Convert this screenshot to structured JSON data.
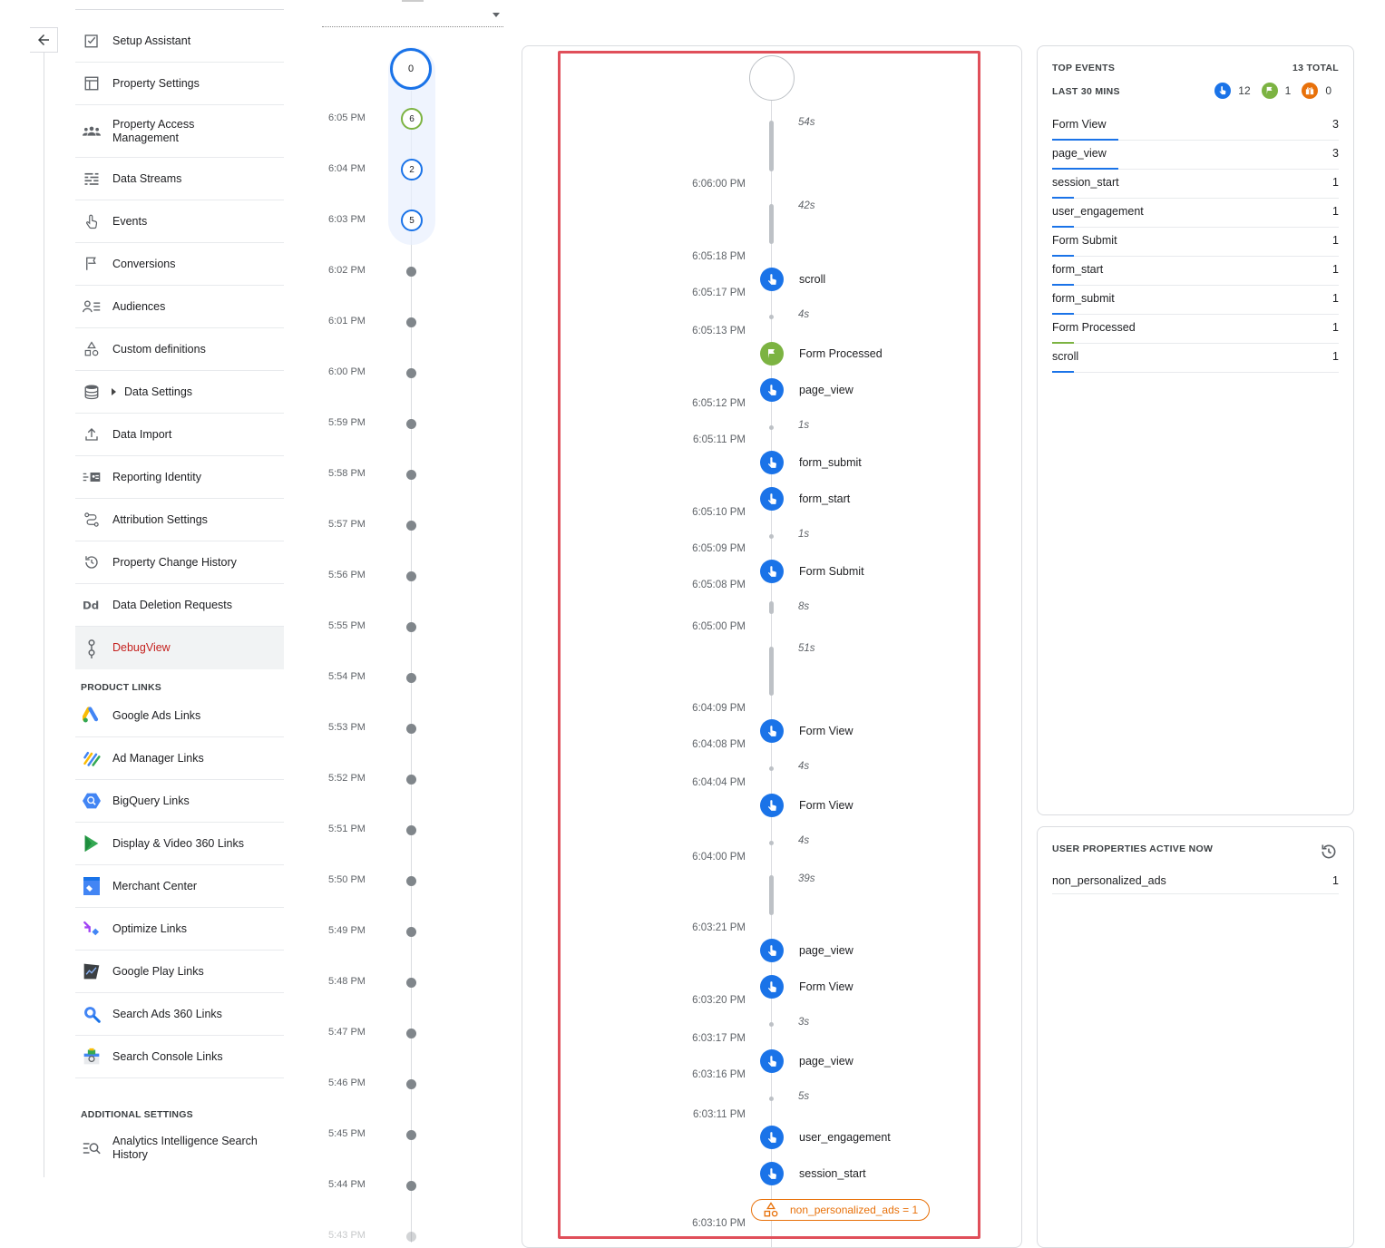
{
  "nav": {
    "items": [
      {
        "label": "Setup Assistant",
        "icon": "checkbox-icon"
      },
      {
        "label": "Property Settings",
        "icon": "layout-icon"
      },
      {
        "label": "Property Access Management",
        "icon": "people-icon"
      },
      {
        "label": "Data Streams",
        "icon": "streams-icon"
      },
      {
        "label": "Events",
        "icon": "touch-icon"
      },
      {
        "label": "Conversions",
        "icon": "flag-icon"
      },
      {
        "label": "Audiences",
        "icon": "audience-icon"
      },
      {
        "label": "Custom definitions",
        "icon": "shapes-icon"
      },
      {
        "label": "Data Settings",
        "icon": "database-icon"
      },
      {
        "label": "Data Import",
        "icon": "upload-icon"
      },
      {
        "label": "Reporting Identity",
        "icon": "identity-icon"
      },
      {
        "label": "Attribution Settings",
        "icon": "attribution-icon"
      },
      {
        "label": "Property Change History",
        "icon": "history-icon"
      },
      {
        "label": "Data Deletion Requests",
        "icon": "dd-icon"
      },
      {
        "label": "DebugView",
        "icon": "debug-icon"
      }
    ],
    "product_links_header": "PRODUCT LINKS",
    "product_links": [
      {
        "label": "Google Ads Links"
      },
      {
        "label": "Ad Manager Links"
      },
      {
        "label": "BigQuery Links"
      },
      {
        "label": "Display & Video 360 Links"
      },
      {
        "label": "Merchant Center"
      },
      {
        "label": "Optimize Links"
      },
      {
        "label": "Google Play Links"
      },
      {
        "label": "Search Ads 360 Links"
      },
      {
        "label": "Search Console Links"
      }
    ],
    "additional_header": "ADDITIONAL SETTINGS",
    "additional": [
      {
        "label": "Analytics Intelligence Search History"
      }
    ]
  },
  "minutes": {
    "current_count": "0",
    "rows": [
      {
        "time": "6:05 PM",
        "count": "6",
        "color": "green"
      },
      {
        "time": "6:04 PM",
        "count": "2",
        "color": "blue"
      },
      {
        "time": "6:03 PM",
        "count": "5",
        "color": "blue"
      },
      {
        "time": "6:02 PM"
      },
      {
        "time": "6:01 PM"
      },
      {
        "time": "6:00 PM"
      },
      {
        "time": "5:59 PM"
      },
      {
        "time": "5:58 PM"
      },
      {
        "time": "5:57 PM"
      },
      {
        "time": "5:56 PM"
      },
      {
        "time": "5:55 PM"
      },
      {
        "time": "5:54 PM"
      },
      {
        "time": "5:53 PM"
      },
      {
        "time": "5:52 PM"
      },
      {
        "time": "5:51 PM"
      },
      {
        "time": "5:50 PM"
      },
      {
        "time": "5:49 PM"
      },
      {
        "time": "5:48 PM"
      },
      {
        "time": "5:47 PM"
      },
      {
        "time": "5:46 PM"
      },
      {
        "time": "5:45 PM"
      },
      {
        "time": "5:44 PM"
      },
      {
        "time": "5:43 PM"
      }
    ]
  },
  "stream": {
    "times": [
      "6:06:00 PM",
      "6:05:18 PM",
      "6:05:17 PM",
      "6:05:13 PM",
      "6:05:12 PM",
      "6:05:11 PM",
      "6:05:10 PM",
      "6:05:09 PM",
      "6:05:08 PM",
      "6:05:00 PM",
      "6:04:09 PM",
      "6:04:08 PM",
      "6:04:04 PM",
      "6:04:00 PM",
      "6:03:21 PM",
      "6:03:20 PM",
      "6:03:17 PM",
      "6:03:16 PM",
      "6:03:11 PM",
      "6:03:10 PM"
    ],
    "gaps": [
      "54s",
      "42s",
      "4s",
      "1s",
      "1s",
      "8s",
      "51s",
      "4s",
      "4s",
      "39s",
      "3s",
      "5s"
    ],
    "events": [
      {
        "name": "scroll",
        "kind": "blue"
      },
      {
        "name": "Form Processed",
        "kind": "green"
      },
      {
        "name": "page_view",
        "kind": "blue"
      },
      {
        "name": "form_submit",
        "kind": "blue"
      },
      {
        "name": "form_start",
        "kind": "blue"
      },
      {
        "name": "Form Submit",
        "kind": "blue"
      },
      {
        "name": "Form View",
        "kind": "blue"
      },
      {
        "name": "Form View",
        "kind": "blue"
      },
      {
        "name": "page_view",
        "kind": "blue"
      },
      {
        "name": "Form View",
        "kind": "blue"
      },
      {
        "name": "page_view",
        "kind": "blue"
      },
      {
        "name": "user_engagement",
        "kind": "blue"
      },
      {
        "name": "session_start",
        "kind": "blue"
      }
    ],
    "user_property_chip": "non_personalized_ads = 1"
  },
  "top_events": {
    "title": "TOP EVENTS",
    "total": "13 TOTAL",
    "period": "LAST 30 MINS",
    "counters": {
      "events": "12",
      "conversions": "1",
      "errors": "0"
    },
    "colors": {
      "blue": "#1a73e8",
      "green": "#7cb342",
      "orange": "#e8710a"
    },
    "items": [
      {
        "name": "Form View",
        "count": "3",
        "bar": "blue"
      },
      {
        "name": "page_view",
        "count": "3",
        "bar": "blue"
      },
      {
        "name": "session_start",
        "count": "1",
        "bar": "blue"
      },
      {
        "name": "user_engagement",
        "count": "1",
        "bar": "blue"
      },
      {
        "name": "Form Submit",
        "count": "1",
        "bar": "blue"
      },
      {
        "name": "form_start",
        "count": "1",
        "bar": "blue"
      },
      {
        "name": "form_submit",
        "count": "1",
        "bar": "blue"
      },
      {
        "name": "Form Processed",
        "count": "1",
        "bar": "green"
      },
      {
        "name": "scroll",
        "count": "1",
        "bar": "blue"
      }
    ]
  },
  "user_properties": {
    "title": "USER PROPERTIES ACTIVE NOW",
    "items": [
      {
        "name": "non_personalized_ads",
        "value": "1"
      }
    ]
  }
}
